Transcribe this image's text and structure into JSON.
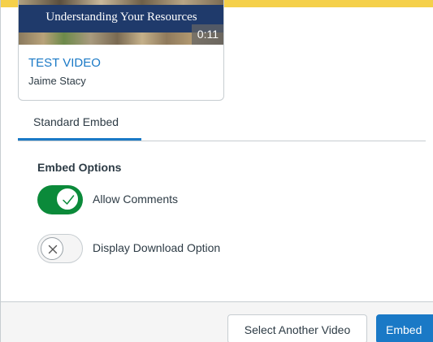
{
  "video": {
    "thumbnail_title": "Understanding Your Resources",
    "duration": "0:11",
    "title": "TEST VIDEO",
    "author": "Jaime Stacy"
  },
  "tabs": [
    {
      "label": "Standard Embed",
      "selected": true
    }
  ],
  "options": {
    "heading": "Embed Options",
    "allow_comments": {
      "label": "Allow Comments",
      "checked": true
    },
    "display_download": {
      "label": "Display Download Option",
      "checked": false
    }
  },
  "footer": {
    "select_another_label": "Select Another Video",
    "embed_label": "Embed"
  },
  "colors": {
    "accent": "#1a79c6",
    "toggle_on": "#0b8a3a",
    "banner": "#f5d04a"
  },
  "icons": {
    "toggle_on": "checkmark-icon",
    "toggle_off": "x-icon"
  }
}
